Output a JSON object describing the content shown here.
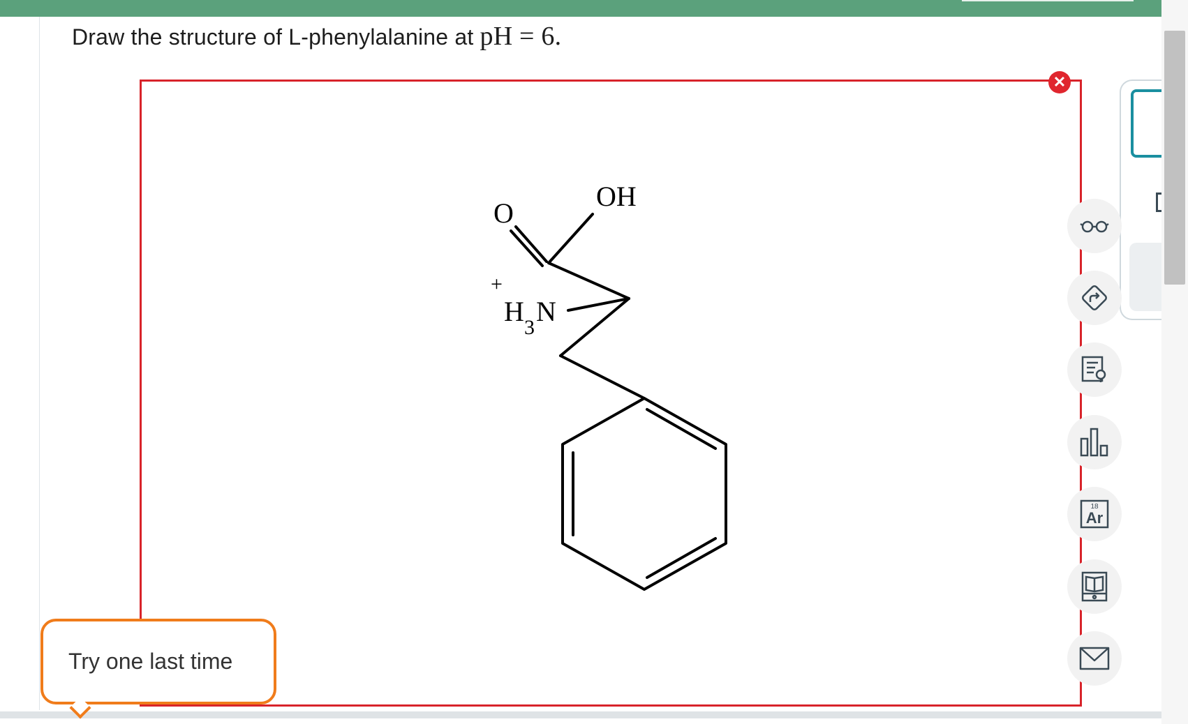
{
  "question": {
    "prefix": "Draw the structure of L-phenylalanine at ",
    "math": "pH = 6."
  },
  "molecule": {
    "carbonyl_o": "O",
    "hydroxyl": "OH",
    "ammonium_charge": "+",
    "ammonium_h": "H",
    "ammonium_sub": "3",
    "ammonium_n": "N"
  },
  "close_symbol": "✕",
  "feedback": {
    "message": "Try one last time"
  },
  "toolbar": {
    "element_mass": "18",
    "element_symbol": "Ar",
    "icons": [
      "glasses-icon",
      "rotate-icon",
      "hint-icon",
      "bar-chart-icon",
      "periodic-table-icon",
      "book-icon",
      "mail-icon"
    ]
  },
  "colors": {
    "header": "#5ba17c",
    "canvas_border": "#d8232a",
    "feedback_border": "#f07c1b",
    "panel_accent": "#1a8fa0",
    "close_badge": "#e0262e"
  }
}
